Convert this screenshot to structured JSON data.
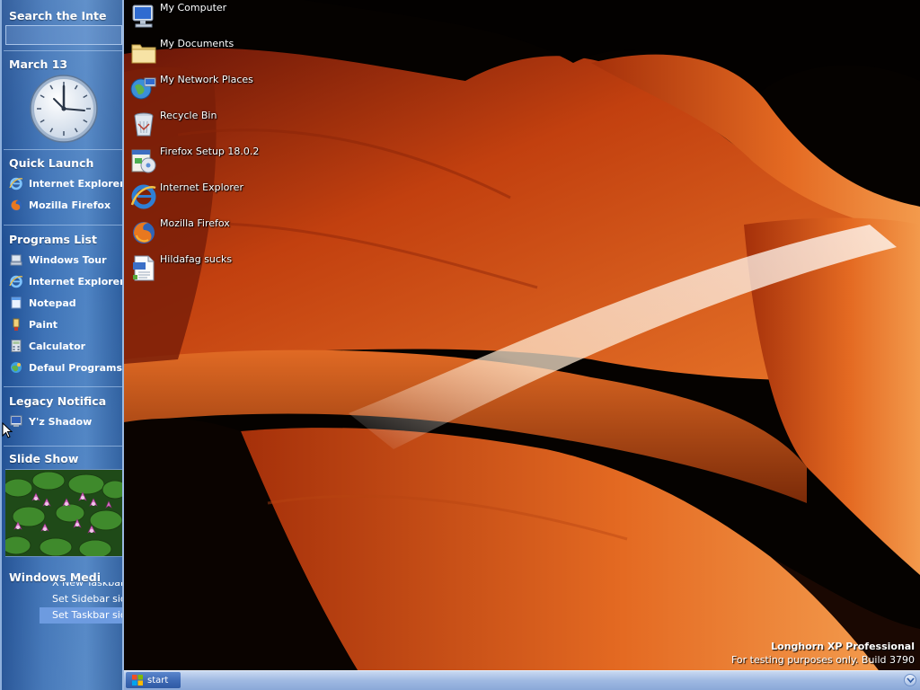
{
  "sidebar": {
    "search": {
      "title": "Search the Inte"
    },
    "calendar": {
      "date": "March 13"
    },
    "quick_launch": {
      "title": "Quick Launch",
      "items": [
        {
          "label": "Internet Explorer",
          "icon": "internet-explorer-icon"
        },
        {
          "label": "Mozilla Firefox",
          "icon": "firefox-icon"
        }
      ]
    },
    "programs_list": {
      "title": "Programs List",
      "items": [
        {
          "label": "Windows Tour",
          "icon": "windows-tour-icon"
        },
        {
          "label": "Internet Explorer",
          "icon": "internet-explorer-icon"
        },
        {
          "label": "Notepad",
          "icon": "notepad-icon"
        },
        {
          "label": "Paint",
          "icon": "paint-icon"
        },
        {
          "label": "Calculator",
          "icon": "calculator-icon"
        },
        {
          "label": "Defaul Programs",
          "icon": "default-programs-icon"
        }
      ]
    },
    "legacy": {
      "title": "Legacy Notifica",
      "items": [
        {
          "label": "Y'z Shadow",
          "icon": "yz-shadow-icon"
        }
      ]
    },
    "slideshow": {
      "title": "Slide Show"
    },
    "media": {
      "title": "Windows Medi",
      "menu": [
        {
          "label": "X New Taskbar"
        },
        {
          "label": "Set Sidebar side"
        },
        {
          "label": "Set Taskbar side"
        }
      ]
    }
  },
  "desktop": {
    "icons": [
      {
        "label": "My Computer",
        "icon": "my-computer-icon"
      },
      {
        "label": "My Documents",
        "icon": "folder-icon"
      },
      {
        "label": "My Network Places",
        "icon": "network-places-icon"
      },
      {
        "label": "Recycle Bin",
        "icon": "recycle-bin-icon"
      },
      {
        "label": "Firefox Setup 18.0.2",
        "icon": "installer-icon"
      },
      {
        "label": "Internet Explorer",
        "icon": "internet-explorer-icon"
      },
      {
        "label": "Mozilla Firefox",
        "icon": "firefox-icon"
      },
      {
        "label": "Hildafag sucks",
        "icon": "text-file-icon"
      }
    ],
    "watermark": {
      "line1": "Longhorn XP Professional",
      "line2": "For testing purposes only. Build 3790"
    }
  },
  "taskbar": {
    "start_label": "start"
  },
  "colors": {
    "sidebar_blue": "#3d72b6",
    "taskbar_blue": "#9fb9e2",
    "canyon_orange": "#d9581c"
  }
}
